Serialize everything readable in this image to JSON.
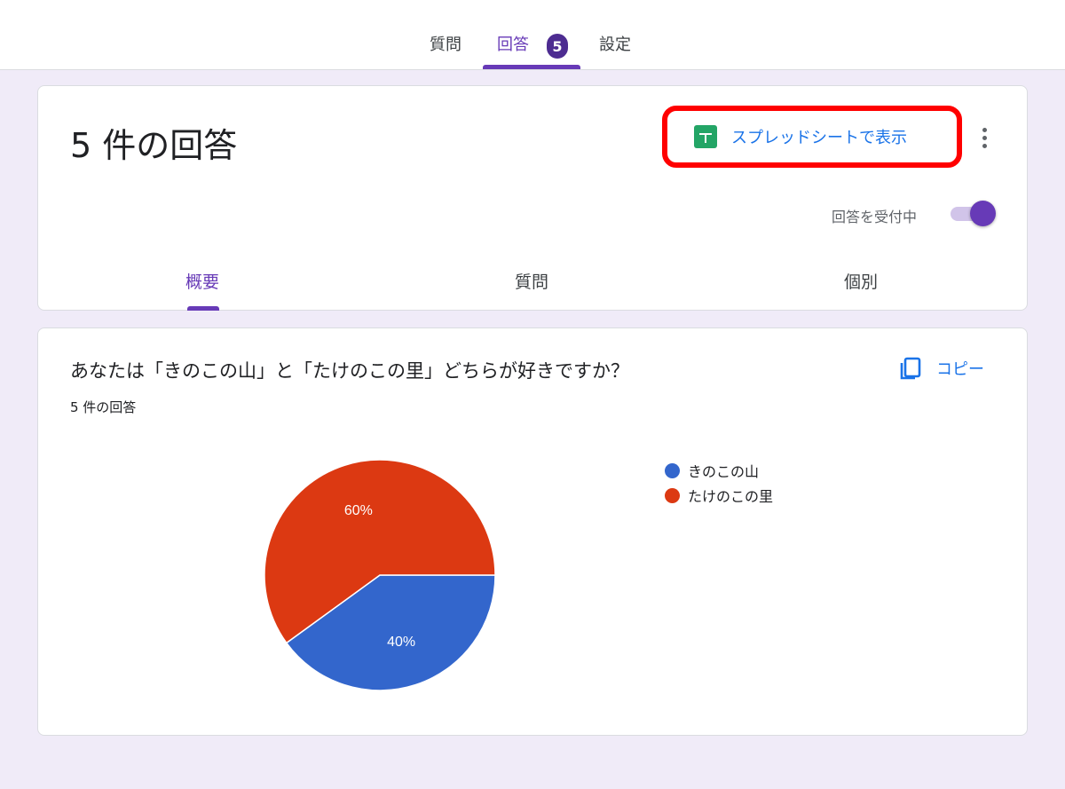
{
  "top_tabs": {
    "questions": "質問",
    "responses": "回答",
    "responses_badge": "5",
    "settings": "設定"
  },
  "summary": {
    "title": "5 件の回答",
    "view_in_sheets": "スプレッドシートで表示",
    "accepting_responses": "回答を受付中",
    "accepting_on": true,
    "tabs": {
      "overview": "概要",
      "question": "質問",
      "individual": "個別"
    }
  },
  "question_card": {
    "title": "あなたは「きのこの山」と「たけのこの里」どちらが好きですか？",
    "response_count": "5 件の回答",
    "copy_label": "コピー"
  },
  "chart_data": {
    "type": "pie",
    "categories": [
      "きのこの山",
      "たけのこの里"
    ],
    "values": [
      40,
      60
    ],
    "data_labels": [
      "40%",
      "60%"
    ],
    "colors": [
      "#3366cc",
      "#dc3912"
    ],
    "legend_position": "right"
  },
  "colors": {
    "accent": "#673ab7",
    "badge": "#4d2c91",
    "link": "#1a73e8",
    "highlight": "#ff0000",
    "sheets_green": "#23a566",
    "page_background": "#f0ebf8"
  }
}
